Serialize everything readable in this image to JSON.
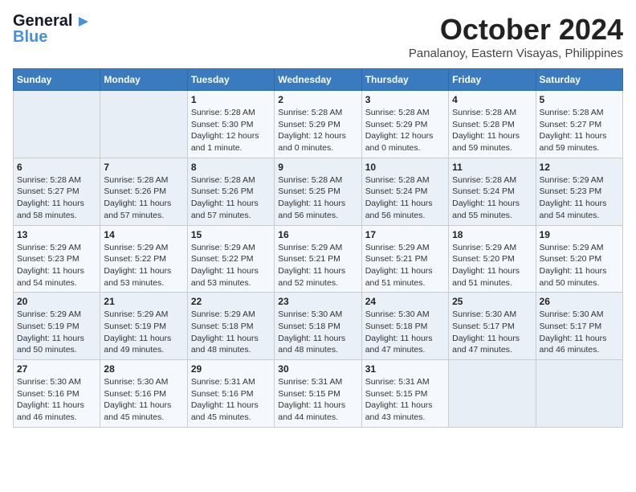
{
  "header": {
    "logo_general": "General",
    "logo_blue": "Blue",
    "month_title": "October 2024",
    "subtitle": "Panalanoy, Eastern Visayas, Philippines"
  },
  "weekdays": [
    "Sunday",
    "Monday",
    "Tuesday",
    "Wednesday",
    "Thursday",
    "Friday",
    "Saturday"
  ],
  "weeks": [
    [
      {
        "day": "",
        "info": ""
      },
      {
        "day": "",
        "info": ""
      },
      {
        "day": "1",
        "info": "Sunrise: 5:28 AM\nSunset: 5:30 PM\nDaylight: 12 hours\nand 1 minute."
      },
      {
        "day": "2",
        "info": "Sunrise: 5:28 AM\nSunset: 5:29 PM\nDaylight: 12 hours\nand 0 minutes."
      },
      {
        "day": "3",
        "info": "Sunrise: 5:28 AM\nSunset: 5:29 PM\nDaylight: 12 hours\nand 0 minutes."
      },
      {
        "day": "4",
        "info": "Sunrise: 5:28 AM\nSunset: 5:28 PM\nDaylight: 11 hours\nand 59 minutes."
      },
      {
        "day": "5",
        "info": "Sunrise: 5:28 AM\nSunset: 5:27 PM\nDaylight: 11 hours\nand 59 minutes."
      }
    ],
    [
      {
        "day": "6",
        "info": "Sunrise: 5:28 AM\nSunset: 5:27 PM\nDaylight: 11 hours\nand 58 minutes."
      },
      {
        "day": "7",
        "info": "Sunrise: 5:28 AM\nSunset: 5:26 PM\nDaylight: 11 hours\nand 57 minutes."
      },
      {
        "day": "8",
        "info": "Sunrise: 5:28 AM\nSunset: 5:26 PM\nDaylight: 11 hours\nand 57 minutes."
      },
      {
        "day": "9",
        "info": "Sunrise: 5:28 AM\nSunset: 5:25 PM\nDaylight: 11 hours\nand 56 minutes."
      },
      {
        "day": "10",
        "info": "Sunrise: 5:28 AM\nSunset: 5:24 PM\nDaylight: 11 hours\nand 56 minutes."
      },
      {
        "day": "11",
        "info": "Sunrise: 5:28 AM\nSunset: 5:24 PM\nDaylight: 11 hours\nand 55 minutes."
      },
      {
        "day": "12",
        "info": "Sunrise: 5:29 AM\nSunset: 5:23 PM\nDaylight: 11 hours\nand 54 minutes."
      }
    ],
    [
      {
        "day": "13",
        "info": "Sunrise: 5:29 AM\nSunset: 5:23 PM\nDaylight: 11 hours\nand 54 minutes."
      },
      {
        "day": "14",
        "info": "Sunrise: 5:29 AM\nSunset: 5:22 PM\nDaylight: 11 hours\nand 53 minutes."
      },
      {
        "day": "15",
        "info": "Sunrise: 5:29 AM\nSunset: 5:22 PM\nDaylight: 11 hours\nand 53 minutes."
      },
      {
        "day": "16",
        "info": "Sunrise: 5:29 AM\nSunset: 5:21 PM\nDaylight: 11 hours\nand 52 minutes."
      },
      {
        "day": "17",
        "info": "Sunrise: 5:29 AM\nSunset: 5:21 PM\nDaylight: 11 hours\nand 51 minutes."
      },
      {
        "day": "18",
        "info": "Sunrise: 5:29 AM\nSunset: 5:20 PM\nDaylight: 11 hours\nand 51 minutes."
      },
      {
        "day": "19",
        "info": "Sunrise: 5:29 AM\nSunset: 5:20 PM\nDaylight: 11 hours\nand 50 minutes."
      }
    ],
    [
      {
        "day": "20",
        "info": "Sunrise: 5:29 AM\nSunset: 5:19 PM\nDaylight: 11 hours\nand 50 minutes."
      },
      {
        "day": "21",
        "info": "Sunrise: 5:29 AM\nSunset: 5:19 PM\nDaylight: 11 hours\nand 49 minutes."
      },
      {
        "day": "22",
        "info": "Sunrise: 5:29 AM\nSunset: 5:18 PM\nDaylight: 11 hours\nand 48 minutes."
      },
      {
        "day": "23",
        "info": "Sunrise: 5:30 AM\nSunset: 5:18 PM\nDaylight: 11 hours\nand 48 minutes."
      },
      {
        "day": "24",
        "info": "Sunrise: 5:30 AM\nSunset: 5:18 PM\nDaylight: 11 hours\nand 47 minutes."
      },
      {
        "day": "25",
        "info": "Sunrise: 5:30 AM\nSunset: 5:17 PM\nDaylight: 11 hours\nand 47 minutes."
      },
      {
        "day": "26",
        "info": "Sunrise: 5:30 AM\nSunset: 5:17 PM\nDaylight: 11 hours\nand 46 minutes."
      }
    ],
    [
      {
        "day": "27",
        "info": "Sunrise: 5:30 AM\nSunset: 5:16 PM\nDaylight: 11 hours\nand 46 minutes."
      },
      {
        "day": "28",
        "info": "Sunrise: 5:30 AM\nSunset: 5:16 PM\nDaylight: 11 hours\nand 45 minutes."
      },
      {
        "day": "29",
        "info": "Sunrise: 5:31 AM\nSunset: 5:16 PM\nDaylight: 11 hours\nand 45 minutes."
      },
      {
        "day": "30",
        "info": "Sunrise: 5:31 AM\nSunset: 5:15 PM\nDaylight: 11 hours\nand 44 minutes."
      },
      {
        "day": "31",
        "info": "Sunrise: 5:31 AM\nSunset: 5:15 PM\nDaylight: 11 hours\nand 43 minutes."
      },
      {
        "day": "",
        "info": ""
      },
      {
        "day": "",
        "info": ""
      }
    ]
  ]
}
